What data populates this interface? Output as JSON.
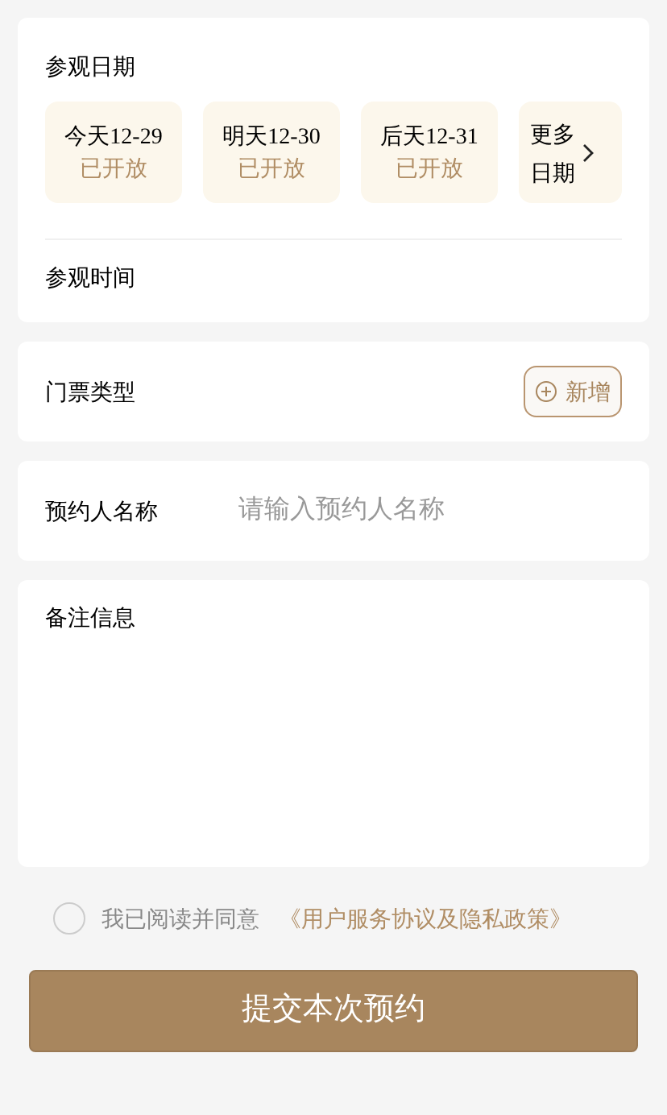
{
  "visit_date": {
    "label": "参观日期",
    "dates": [
      {
        "day": "今天12-29",
        "status": "已开放"
      },
      {
        "day": "明天12-30",
        "status": "已开放"
      },
      {
        "day": "后天12-31",
        "status": "已开放"
      }
    ],
    "more": {
      "line1": "更多",
      "line2": "日期"
    }
  },
  "visit_time": {
    "label": "参观时间"
  },
  "ticket_type": {
    "label": "门票类型",
    "add_button": "新增"
  },
  "booker": {
    "label": "预约人名称",
    "placeholder": "请输入预约人名称"
  },
  "remarks": {
    "label": "备注信息"
  },
  "agreement": {
    "checked": false,
    "text": "我已阅读并同意",
    "link": "《用户服务协议及隐私政策》"
  },
  "submit": "提交本次预约"
}
